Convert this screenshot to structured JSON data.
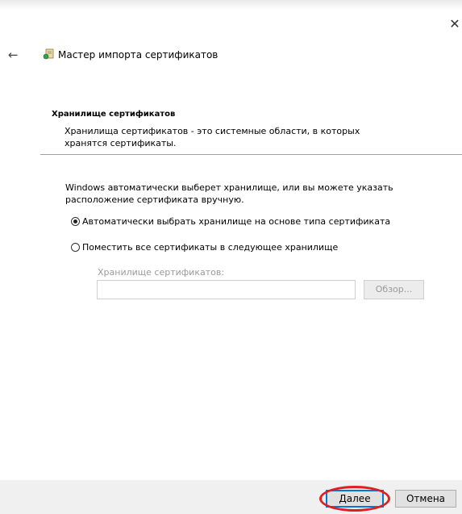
{
  "window": {
    "close_glyph": "✕",
    "back_glyph": "←",
    "title": "Мастер импорта сертификатов",
    "icon": "certificate-wizard-icon"
  },
  "section": {
    "title": "Хранилище сертификатов",
    "description": "Хранилища сертификатов - это системные области, в которых хранятся сертификаты."
  },
  "content": {
    "intro": "Windows автоматически выберет хранилище, или вы можете указать расположение сертификата вручную.",
    "options": [
      {
        "label": "Автоматически выбрать хранилище на основе типа сертификата",
        "checked": true
      },
      {
        "label": "Поместить все сертификаты в следующее хранилище",
        "checked": false
      }
    ],
    "store_label": "Хранилище сертификатов:",
    "store_value": "",
    "browse_label": "Обзор..."
  },
  "footer": {
    "next_accel": "Д",
    "next_rest": "алее",
    "cancel_label": "Отмена"
  },
  "colors": {
    "focus_border": "#0078d7",
    "annotation": "#e02020",
    "footer_bg": "#f0f0f0"
  }
}
